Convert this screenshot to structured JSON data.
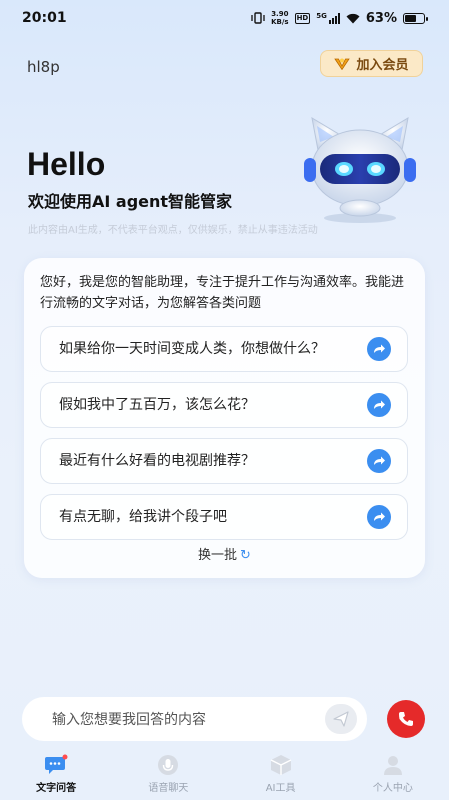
{
  "status_bar": {
    "time": "20:01",
    "net_speed_value": "3.90",
    "net_speed_unit": "KB/s",
    "hd": "HD",
    "network": "5G",
    "battery": "63%",
    "battery_level": 0.63
  },
  "header": {
    "username": "hl8p",
    "vip_label": "加入会员"
  },
  "hero": {
    "title": "Hello",
    "subtitle": "欢迎使用AI agent智能管家",
    "disclaimer": "此内容由AI生成，不代表平台观点，仅供娱乐，禁止从事违法活动"
  },
  "card": {
    "intro": "您好，我是您的智能助理，专注于提升工作与沟通效率。我能进行流畅的文字对话，为您解答各类问题",
    "questions": [
      "如果给你一天时间变成人类，你想做什么？",
      "假如我中了五百万，该怎么花？",
      "最近有什么好看的电视剧推荐？",
      "有点无聊，给我讲个段子吧"
    ],
    "refresh_label": "换一批"
  },
  "input": {
    "placeholder": "输入您想要我回答的内容"
  },
  "tabs": [
    {
      "label": "文字问答",
      "icon": "chat-icon",
      "active": true
    },
    {
      "label": "语音聊天",
      "icon": "voice-icon",
      "active": false
    },
    {
      "label": "AI工具",
      "icon": "cube-icon",
      "active": false
    },
    {
      "label": "个人中心",
      "icon": "user-icon",
      "active": false
    }
  ],
  "colors": {
    "accent": "#3b8ef0",
    "call": "#e52a2a",
    "vip_bg": "#fbe9c7"
  }
}
